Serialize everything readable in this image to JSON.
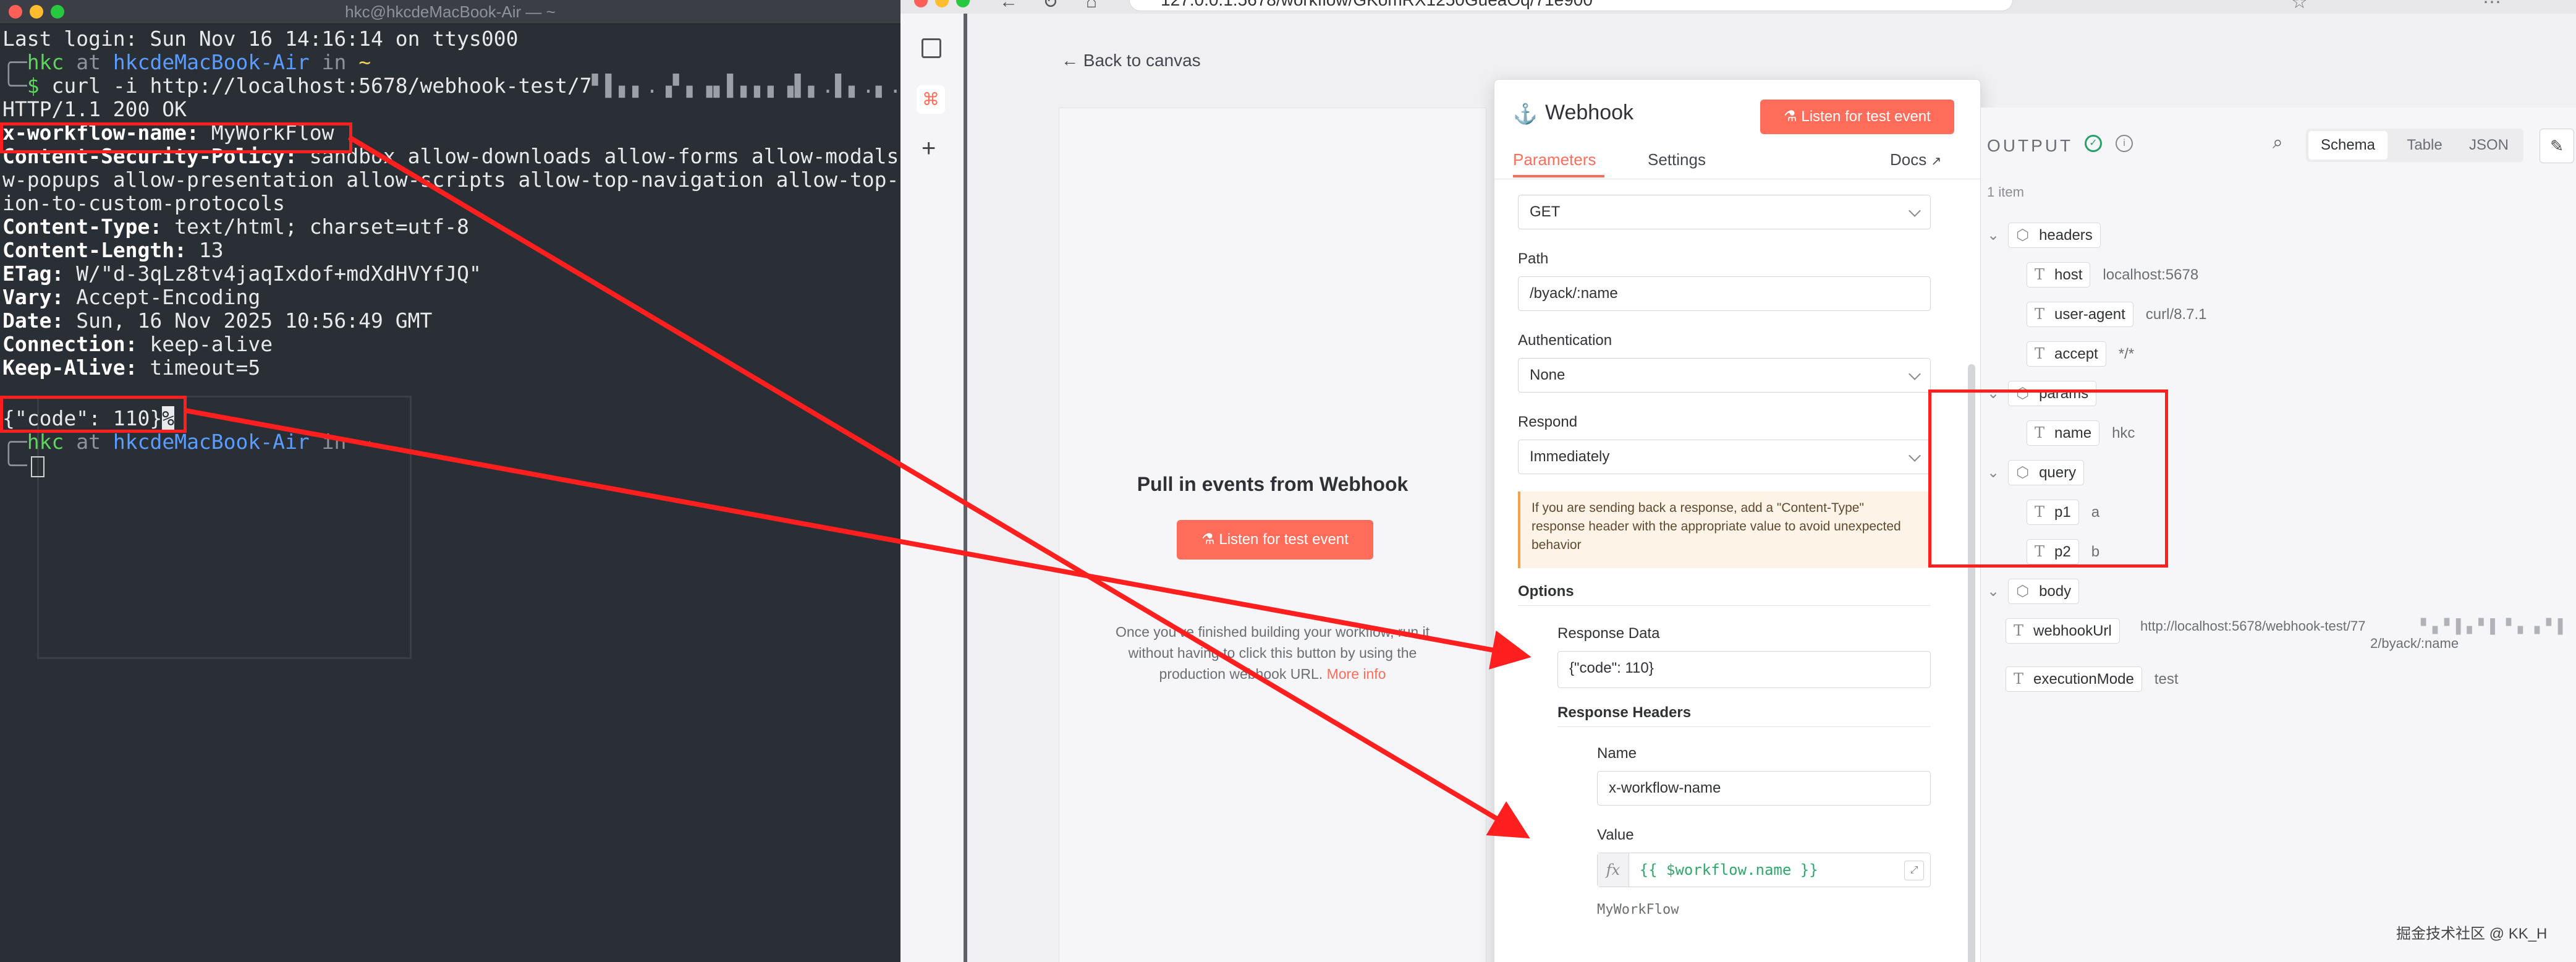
{
  "terminal": {
    "title": "hkc@hkcdeMacBook-Air — ~",
    "last_login": "Last login: Sun Nov 16 14:16:14 on ttys000",
    "prompt_user": "hkc",
    "prompt_at": "at",
    "prompt_host": "hkcdeMacBook-Air",
    "prompt_in": "in",
    "prompt_dir": "~",
    "command": "curl -i http://localhost:5678/webhook-test/7",
    "status_line": "HTTP/1.1 200 OK",
    "headers": [
      {
        "key": "x-workflow-name:",
        "value": " MyWorkFlow"
      },
      {
        "key": "Content-Security-Policy:",
        "value": " sandbox allow-downloads allow-forms allow-modals"
      },
      {
        "key": "",
        "value": "w-popups allow-presentation allow-scripts allow-top-navigation allow-top-"
      },
      {
        "key": "",
        "value": "ion-to-custom-protocols"
      },
      {
        "key": "Content-Type:",
        "value": " text/html; charset=utf-8"
      },
      {
        "key": "Content-Length:",
        "value": " 13"
      },
      {
        "key": "ETag:",
        "value": " W/\"d-3qLz8tv4jaqIxdof+mdXdHVYfJQ\""
      },
      {
        "key": "Vary:",
        "value": " Accept-Encoding"
      },
      {
        "key": "Date:",
        "value": " Sun, 16 Nov 2025 10:56:49 GMT"
      },
      {
        "key": "Connection:",
        "value": " keep-alive"
      },
      {
        "key": "Keep-Alive:",
        "value": " timeout=5"
      }
    ],
    "body_line": "{\"code\": 110}",
    "percent_marker": "%"
  },
  "browser": {
    "url": "127.0.0.1:5678/workflow/GKomRX1250GueaOq/71e900"
  },
  "modal": {
    "back_label": "Back to canvas",
    "input_panel": {
      "title": "Pull in events from Webhook",
      "listen_button": "Listen for test event",
      "description": "Once you've finished building your workflow, run it without having to click this button by using the production webhook URL.",
      "more_info": "More info"
    },
    "node": {
      "title": "Webhook",
      "listen_button": "Listen for test event",
      "tabs": [
        "Parameters",
        "Settings"
      ],
      "docs_label": "Docs",
      "http_method_value": "GET",
      "path_label": "Path",
      "path_value": "/byack/:name",
      "auth_label": "Authentication",
      "auth_value": "None",
      "respond_label": "Respond",
      "respond_value": "Immediately",
      "notice": "If you are sending back a response, add a \"Content-Type\" response header with the appropriate value to avoid unexpected behavior",
      "options_label": "Options",
      "response_data_label": "Response Data",
      "response_data_value": "{\"code\": 110}",
      "response_headers_label": "Response Headers",
      "name_label": "Name",
      "name_value": "x-workflow-name",
      "value_label": "Value",
      "value_expression": "{{ $workflow.name }}",
      "value_preview": "MyWorkFlow"
    },
    "output": {
      "title": "OUTPUT",
      "item_count": "1 item",
      "view_tabs": [
        "Schema",
        "Table",
        "JSON"
      ],
      "tree": {
        "headers": {
          "label": "headers",
          "children": [
            {
              "key": "host",
              "value": "localhost:5678"
            },
            {
              "key": "user-agent",
              "value": "curl/8.7.1"
            },
            {
              "key": "accept",
              "value": "*/*"
            }
          ]
        },
        "params": {
          "label": "params",
          "children": [
            {
              "key": "name",
              "value": "hkc"
            }
          ]
        },
        "query": {
          "label": "query",
          "children": [
            {
              "key": "p1",
              "value": "a"
            },
            {
              "key": "p2",
              "value": "b"
            }
          ]
        },
        "body": {
          "label": "body"
        },
        "webhookUrl": {
          "key": "webhookUrl",
          "value": "http://localhost:5678/webhook-test/77",
          "value2": "2/byack/:name"
        },
        "executionMode": {
          "key": "executionMode",
          "value": "test"
        }
      }
    }
  },
  "watermark": "掘金技术社区 @ KK_H",
  "colors": {
    "accent": "#ff6d5a",
    "annotation": "#ff1f1f",
    "terminal_bg": "#2a2e35"
  }
}
